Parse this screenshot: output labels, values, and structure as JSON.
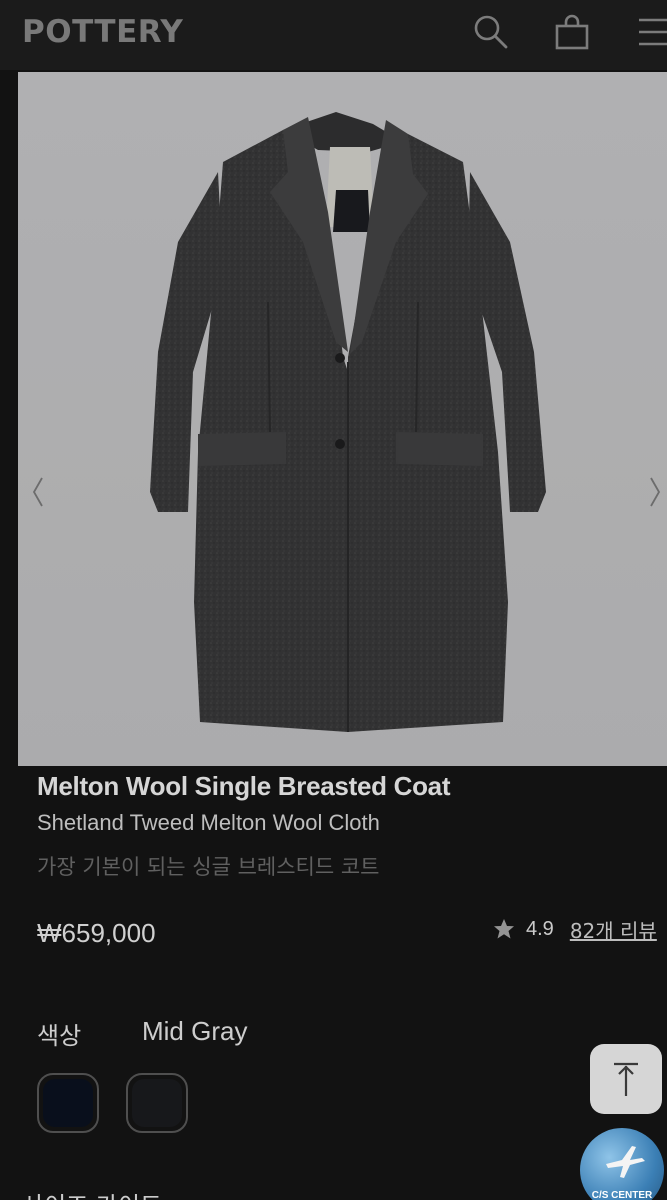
{
  "header": {
    "logo": "POTTERY",
    "icons": [
      "search-icon",
      "shopping-bag-icon",
      "menu-icon"
    ]
  },
  "product": {
    "title": "Melton Wool Single Breasted Coat",
    "subtitle": "Shetland Tweed Melton Wool Cloth",
    "description": "가장 기본이 되는 싱글 브레스티드 코트",
    "price": "₩659,000",
    "rating": "4.9",
    "reviews": "82개 리뷰"
  },
  "options": {
    "color_label": "색상",
    "color_value": "Mid Gray",
    "swatches": [
      {
        "name": "navy",
        "color": "#0b1220"
      },
      {
        "name": "mid-gray",
        "color": "#1b1c1f"
      }
    ]
  },
  "floating": {
    "cs_label": "C/S CENTER"
  },
  "size_guide": "사이즈 가이드",
  "colors": {
    "background": "#151515",
    "header": "#1f1f1f",
    "gallery": "#c7c7c9"
  }
}
